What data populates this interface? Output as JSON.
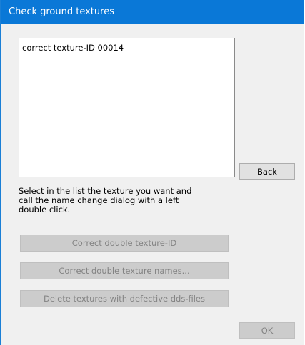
{
  "window": {
    "title": "Check ground textures"
  },
  "list": {
    "items": [
      "correct texture-ID 00014"
    ]
  },
  "buttons": {
    "back": "Back",
    "correct_double_id": "Correct double texture-ID",
    "correct_double_names": "Correct double texture names...",
    "delete_defective": "Delete textures with defective dds-files",
    "ok": "OK"
  },
  "instructions": {
    "line1": "Select in the list the texture you want and",
    "line2": "call the name change dialog with a left",
    "line3": "double click."
  },
  "colors": {
    "titlebar": "#0a78d7",
    "window_background": "#f0f0f0",
    "disabled_button": "#cccccc",
    "disabled_text": "#838383"
  }
}
